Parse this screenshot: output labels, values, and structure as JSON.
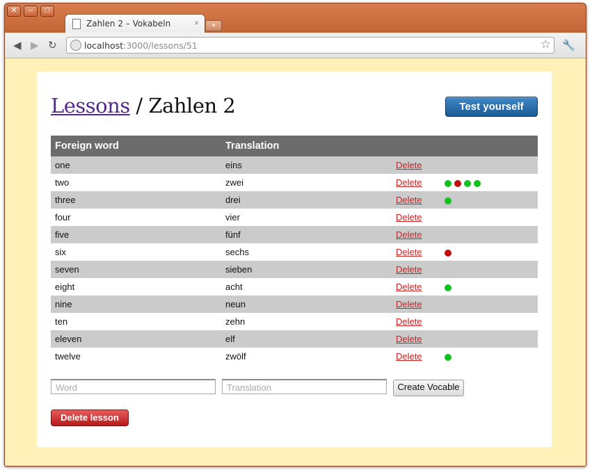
{
  "tab": {
    "title": "Zahlen 2 – Vokabeln",
    "close": "×"
  },
  "window_controls": {
    "close": "✕",
    "minimize": "–",
    "maximize": "□"
  },
  "address": {
    "host": "localhost",
    "path": ":3000/lessons/51"
  },
  "page": {
    "breadcrumb_link": "Lessons",
    "separator": " / ",
    "title": "Zahlen 2",
    "test_button": "Test yourself"
  },
  "table": {
    "headers": [
      "Foreign word",
      "Translation",
      "",
      ""
    ],
    "delete_label": "Delete",
    "rows": [
      {
        "word": "one",
        "translation": "eins",
        "results": []
      },
      {
        "word": "two",
        "translation": "zwei",
        "results": [
          "green",
          "red",
          "green",
          "green"
        ]
      },
      {
        "word": "three",
        "translation": "drei",
        "results": [
          "green"
        ]
      },
      {
        "word": "four",
        "translation": "vier",
        "results": []
      },
      {
        "word": "five",
        "translation": "fünf",
        "results": []
      },
      {
        "word": "six",
        "translation": "sechs",
        "results": [
          "red"
        ]
      },
      {
        "word": "seven",
        "translation": "sieben",
        "results": []
      },
      {
        "word": "eight",
        "translation": "acht",
        "results": [
          "green"
        ]
      },
      {
        "word": "nine",
        "translation": "neun",
        "results": []
      },
      {
        "word": "ten",
        "translation": "zehn",
        "results": []
      },
      {
        "word": "eleven",
        "translation": "elf",
        "results": []
      },
      {
        "word": "twelve",
        "translation": "zwölf",
        "results": [
          "green"
        ]
      }
    ]
  },
  "form": {
    "word_placeholder": "Word",
    "translation_placeholder": "Translation",
    "create_button": "Create Vocable"
  },
  "delete_lesson": "Delete lesson",
  "colors": {
    "green": "#11c11e",
    "red": "#c10f0f",
    "frame": "#c96a3a",
    "viewport": "#fff1b8"
  }
}
